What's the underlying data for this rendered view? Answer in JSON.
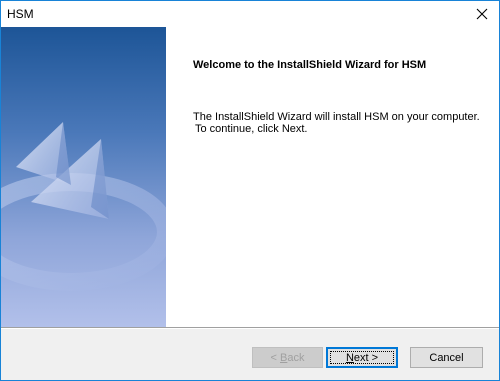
{
  "window": {
    "title": "HSM"
  },
  "welcome": {
    "heading": "Welcome to the InstallShield Wizard for HSM",
    "line1": "The InstallShield Wizard will install HSM on your computer.",
    "line2": "To continue, click Next."
  },
  "buttons": {
    "back": {
      "prefix": "< ",
      "mnemonic": "B",
      "rest": "ack"
    },
    "next": {
      "mnemonic": "N",
      "rest": "ext >"
    },
    "cancel": "Cancel"
  },
  "colors": {
    "banner_top": "#1f5a9c",
    "banner_bottom": "#aebde6",
    "accent": "#0078d7"
  },
  "icons": {
    "close": "close-icon",
    "banner": "installshield-banner-graphic"
  }
}
